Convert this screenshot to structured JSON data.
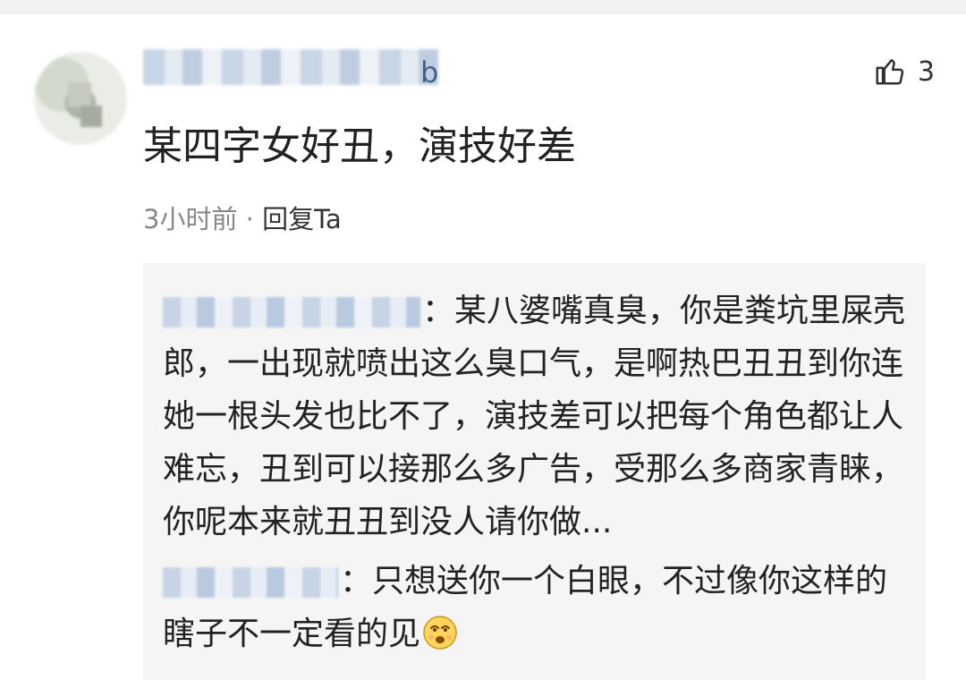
{
  "comment": {
    "author_tail": "b",
    "likes": "3",
    "text": "某四字女好丑，演技好差",
    "time": "3小时前",
    "separator": " · ",
    "reply_label": "回复Ta"
  },
  "replies": [
    {
      "text": "：某八婆嘴真臭，你是粪坑里屎壳郎，一出现就喷出这么臭口气，是啊热巴丑丑到你连她一根头发也比不了，演技差可以把每个角色都让人难忘，丑到可以接那么多广告，受那么多商家青睐，你呢本来就丑丑到没人请你做..."
    },
    {
      "text": "：只想送你一个白眼，不过像你这样的瞎子不一定看的见",
      "emoji": "eye-roll-emoji"
    }
  ],
  "icons": {
    "like": "thumbs-up-icon"
  },
  "colors": {
    "reply_background": "#f5f5f5",
    "meta_text": "#888888",
    "name_blue": "#3f5f8f"
  }
}
